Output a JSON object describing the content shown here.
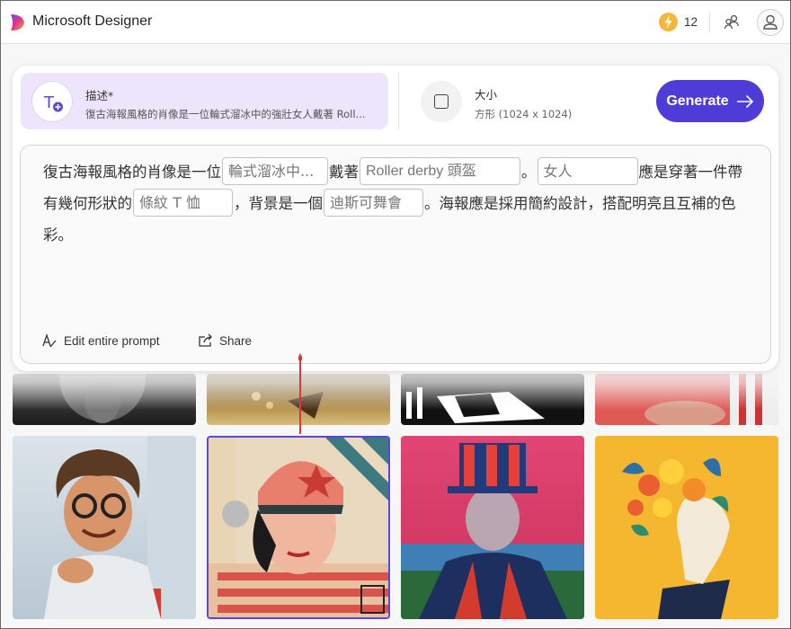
{
  "app": {
    "title": "Microsoft Designer",
    "credits": "12"
  },
  "description": {
    "label": "描述*",
    "text": "復古海報風格的肖像是一位輪式溜冰中的強壯女人戴著 Roll..."
  },
  "size": {
    "label": "大小",
    "value": "方形 (1024 x 1024)"
  },
  "generate_label": "Generate",
  "prompt": {
    "seg1": "復古海報風格的肖像是一位",
    "slot1": "輪式溜冰中...",
    "seg2": "戴著",
    "slot2": "Roller derby 頭盔",
    "seg3": "。",
    "slot3": "女人",
    "seg4": "應是穿著一件帶有幾何形狀的",
    "slot4": "條紋 T 恤",
    "seg5": "，背景是一個",
    "slot5": "迪斯可舞會",
    "seg6": "。海報應是採用簡約設計，搭配明亮且互補的色彩。"
  },
  "actions": {
    "edit_label": "Edit entire prompt",
    "share_label": "Share"
  },
  "colors": {
    "accent": "#4f3bd8",
    "description_bg": "#ece5fb",
    "arrow": "#d8393f"
  },
  "icons": {
    "logo": "designer-logo-icon",
    "credits": "lightning-icon",
    "people": "share-people-icon",
    "account": "user-icon",
    "description": "text-plus-icon",
    "size": "square-icon",
    "generate": "arrow-right-icon",
    "edit": "text-edit-icon",
    "share": "share-icon"
  }
}
